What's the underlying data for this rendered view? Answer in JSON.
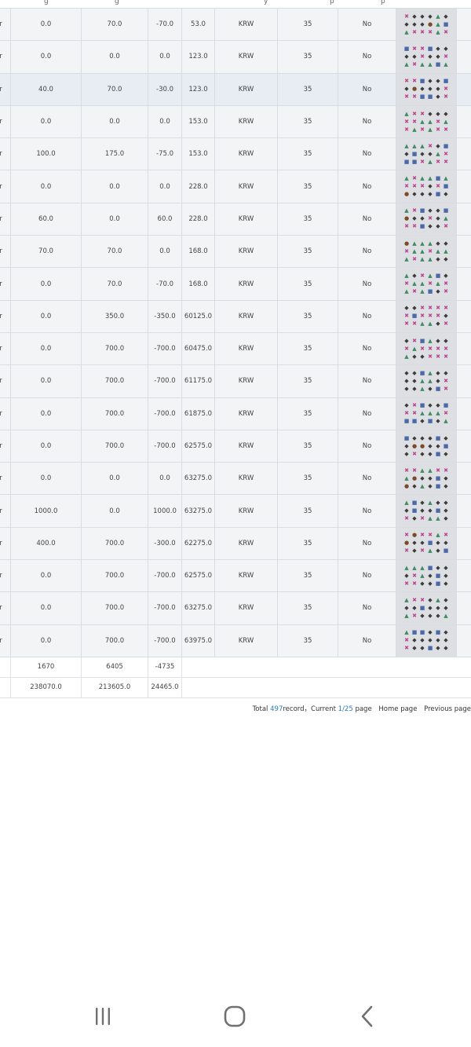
{
  "table": {
    "rows": [
      {
        "c1": "0.0",
        "c2": "70.0",
        "c3": "-70.0",
        "c4": "53.0",
        "c5": "KRW",
        "c6": "35",
        "c7": "No",
        "icons": [
          "pink",
          "dark",
          "dark",
          "dark",
          "green",
          "dark",
          "dark",
          "dark",
          "dark",
          "brown",
          "green",
          "blue",
          "green",
          "pink",
          "pink",
          "pink",
          "green",
          "pink"
        ]
      },
      {
        "c1": "0.0",
        "c2": "0.0",
        "c3": "0.0",
        "c4": "123.0",
        "c5": "KRW",
        "c6": "35",
        "c7": "No",
        "icons": [
          "blue",
          "pink",
          "pink",
          "blue",
          "dark",
          "dark",
          "dark",
          "dark",
          "pink",
          "dark",
          "dark",
          "pink",
          "green",
          "pink",
          "green",
          "green",
          "blue",
          "green"
        ]
      },
      {
        "c1": "40.0",
        "c2": "70.0",
        "c3": "-30.0",
        "c4": "123.0",
        "c5": "KRW",
        "c6": "35",
        "c7": "No",
        "highlight": true,
        "icons": [
          "pink",
          "pink",
          "blue",
          "dark",
          "dark",
          "blue",
          "dark",
          "brown",
          "dark",
          "dark",
          "dark",
          "pink",
          "pink",
          "pink",
          "blue",
          "blue",
          "dark",
          "pink"
        ]
      },
      {
        "c1": "0.0",
        "c2": "0.0",
        "c3": "0.0",
        "c4": "153.0",
        "c5": "KRW",
        "c6": "35",
        "c7": "No",
        "icons": [
          "green",
          "pink",
          "pink",
          "dark",
          "dark",
          "dark",
          "pink",
          "pink",
          "green",
          "green",
          "pink",
          "green",
          "pink",
          "green",
          "pink",
          "green",
          "pink",
          "pink"
        ]
      },
      {
        "c1": "100.0",
        "c2": "175.0",
        "c3": "-75.0",
        "c4": "153.0",
        "c5": "KRW",
        "c6": "35",
        "c7": "No",
        "icons": [
          "green",
          "green",
          "green",
          "pink",
          "dark",
          "blue",
          "dark",
          "blue",
          "dark",
          "dark",
          "green",
          "pink",
          "blue",
          "blue",
          "pink",
          "green",
          "pink",
          "pink"
        ]
      },
      {
        "c1": "0.0",
        "c2": "0.0",
        "c3": "0.0",
        "c4": "228.0",
        "c5": "KRW",
        "c6": "35",
        "c7": "No",
        "icons": [
          "green",
          "pink",
          "green",
          "green",
          "blue",
          "green",
          "pink",
          "pink",
          "pink",
          "dark",
          "pink",
          "blue",
          "brown",
          "dark",
          "dark",
          "dark",
          "blue",
          "dark"
        ]
      },
      {
        "c1": "60.0",
        "c2": "0.0",
        "c3": "60.0",
        "c4": "228.0",
        "c5": "KRW",
        "c6": "35",
        "c7": "No",
        "icons": [
          "green",
          "pink",
          "blue",
          "dark",
          "dark",
          "blue",
          "brown",
          "dark",
          "dark",
          "pink",
          "dark",
          "green",
          "pink",
          "pink",
          "blue",
          "dark",
          "dark",
          "pink"
        ]
      },
      {
        "c1": "70.0",
        "c2": "70.0",
        "c3": "0.0",
        "c4": "168.0",
        "c5": "KRW",
        "c6": "35",
        "c7": "No",
        "icons": [
          "brown",
          "green",
          "green",
          "green",
          "dark",
          "dark",
          "pink",
          "green",
          "green",
          "pink",
          "green",
          "green",
          "green",
          "pink",
          "green",
          "green",
          "dark",
          "dark"
        ]
      },
      {
        "c1": "0.0",
        "c2": "70.0",
        "c3": "-70.0",
        "c4": "168.0",
        "c5": "KRW",
        "c6": "35",
        "c7": "No",
        "icons": [
          "green",
          "dark",
          "pink",
          "green",
          "blue",
          "dark",
          "pink",
          "green",
          "green",
          "pink",
          "green",
          "pink",
          "green",
          "pink",
          "green",
          "blue",
          "dark",
          "pink"
        ]
      },
      {
        "c1": "0.0",
        "c2": "350.0",
        "c3": "-350.0",
        "c4": "60125.0",
        "c5": "KRW",
        "c6": "35",
        "c7": "No",
        "icons": [
          "dark",
          "dark",
          "pink",
          "pink",
          "pink",
          "pink",
          "pink",
          "blue",
          "pink",
          "pink",
          "pink",
          "dark",
          "pink",
          "pink",
          "green",
          "green",
          "dark",
          "pink"
        ]
      },
      {
        "c1": "0.0",
        "c2": "700.0",
        "c3": "-700.0",
        "c4": "60475.0",
        "c5": "KRW",
        "c6": "35",
        "c7": "No",
        "icons": [
          "dark",
          "pink",
          "blue",
          "green",
          "dark",
          "dark",
          "pink",
          "green",
          "pink",
          "pink",
          "pink",
          "pink",
          "green",
          "dark",
          "dark",
          "pink",
          "pink",
          "pink"
        ]
      },
      {
        "c1": "0.0",
        "c2": "700.0",
        "c3": "-700.0",
        "c4": "61175.0",
        "c5": "KRW",
        "c6": "35",
        "c7": "No",
        "icons": [
          "dark",
          "dark",
          "blue",
          "green",
          "dark",
          "dark",
          "dark",
          "dark",
          "green",
          "green",
          "dark",
          "pink",
          "dark",
          "dark",
          "green",
          "dark",
          "blue",
          "pink"
        ]
      },
      {
        "c1": "0.0",
        "c2": "700.0",
        "c3": "-700.0",
        "c4": "61875.0",
        "c5": "KRW",
        "c6": "35",
        "c7": "No",
        "icons": [
          "dark",
          "pink",
          "blue",
          "dark",
          "dark",
          "blue",
          "pink",
          "pink",
          "green",
          "green",
          "green",
          "pink",
          "blue",
          "blue",
          "dark",
          "blue",
          "dark",
          "green"
        ]
      },
      {
        "c1": "0.0",
        "c2": "700.0",
        "c3": "-700.0",
        "c4": "62575.0",
        "c5": "KRW",
        "c6": "35",
        "c7": "No",
        "icons": [
          "blue",
          "dark",
          "dark",
          "dark",
          "blue",
          "dark",
          "dark",
          "brown",
          "brown",
          "dark",
          "dark",
          "blue",
          "dark",
          "pink",
          "dark",
          "dark",
          "blue",
          "dark"
        ]
      },
      {
        "c1": "0.0",
        "c2": "0.0",
        "c3": "0.0",
        "c4": "63275.0",
        "c5": "KRW",
        "c6": "35",
        "c7": "No",
        "icons": [
          "pink",
          "pink",
          "green",
          "green",
          "pink",
          "pink",
          "green",
          "brown",
          "dark",
          "dark",
          "blue",
          "dark",
          "brown",
          "dark",
          "green",
          "dark",
          "blue",
          "dark"
        ]
      },
      {
        "c1": "1000.0",
        "c2": "0.0",
        "c3": "1000.0",
        "c4": "63275.0",
        "c5": "KRW",
        "c6": "35",
        "c7": "No",
        "icons": [
          "green",
          "blue",
          "dark",
          "green",
          "dark",
          "dark",
          "dark",
          "blue",
          "dark",
          "dark",
          "blue",
          "dark",
          "pink",
          "dark",
          "pink",
          "green",
          "green",
          "dark"
        ]
      },
      {
        "c1": "400.0",
        "c2": "700.0",
        "c3": "-300.0",
        "c4": "62275.0",
        "c5": "KRW",
        "c6": "35",
        "c7": "No",
        "icons": [
          "pink",
          "brown",
          "pink",
          "pink",
          "green",
          "pink",
          "brown",
          "dark",
          "dark",
          "blue",
          "dark",
          "dark",
          "pink",
          "dark",
          "pink",
          "green",
          "dark",
          "blue"
        ]
      },
      {
        "c1": "0.0",
        "c2": "700.0",
        "c3": "-700.0",
        "c4": "62575.0",
        "c5": "KRW",
        "c6": "35",
        "c7": "No",
        "icons": [
          "green",
          "green",
          "green",
          "blue",
          "dark",
          "dark",
          "dark",
          "pink",
          "green",
          "dark",
          "blue",
          "dark",
          "pink",
          "pink",
          "dark",
          "dark",
          "blue",
          "dark"
        ]
      },
      {
        "c1": "0.0",
        "c2": "700.0",
        "c3": "-700.0",
        "c4": "63275.0",
        "c5": "KRW",
        "c6": "35",
        "c7": "No",
        "icons": [
          "green",
          "pink",
          "pink",
          "dark",
          "green",
          "dark",
          "dark",
          "dark",
          "blue",
          "dark",
          "dark",
          "dark",
          "green",
          "pink",
          "dark",
          "dark",
          "dark",
          "green"
        ]
      },
      {
        "c1": "0.0",
        "c2": "700.0",
        "c3": "-700.0",
        "c4": "63975.0",
        "c5": "KRW",
        "c6": "35",
        "c7": "No",
        "icons": [
          "green",
          "blue",
          "blue",
          "dark",
          "blue",
          "dark",
          "pink",
          "dark",
          "dark",
          "dark",
          "dark",
          "dark",
          "pink",
          "dark",
          "dark",
          "blue",
          "dark",
          "dark"
        ]
      }
    ],
    "edge_char": "r",
    "right_edge_char": "2",
    "subtotal": {
      "c1": "1670",
      "c2": "6405",
      "c3": "-4735"
    },
    "total": {
      "c1": "238070.0",
      "c2": "213605.0",
      "c3": "24465.0"
    }
  },
  "pagination": {
    "total_prefix": "Total ",
    "total_count": "497",
    "total_suffix": "record，",
    "current_prefix": "Current ",
    "current_page": "1/25",
    "page_suffix": " page",
    "home": "Home page",
    "previous": "Previous page"
  },
  "navbar": {
    "recent_icon": "recent-apps-icon",
    "home_icon": "home-icon",
    "back_icon": "back-icon"
  }
}
